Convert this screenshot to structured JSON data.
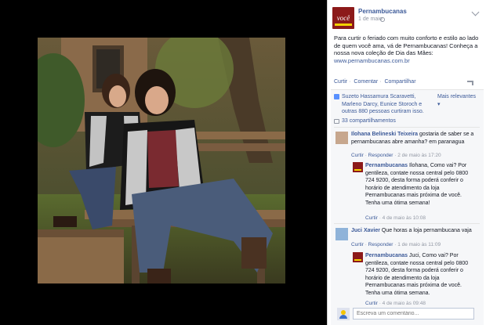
{
  "post": {
    "page_name": "Pernambucanas",
    "avatar_text": "você",
    "date": "1 de maio",
    "text": "Para curtir o feriado com muito conforto e estilo ao lado de quem você ama, vá de Pernambucanas! Conheça a nossa nova coleção de Dia das Mães:",
    "link": "www.pernambucanas.com.br"
  },
  "actions": {
    "like": "Curtir",
    "comment": "Comentar",
    "share": "Compartilhar",
    "sep": "·"
  },
  "likes": {
    "text": "Suzeto Hassamura Scaravetti, Marleno Darcy, Eunice Storoch e outras 880 pessoas curtiram isso.",
    "sort": "Mais relevantes ▾"
  },
  "shares": {
    "text": "33 compartilhamentos"
  },
  "comments": [
    {
      "author": "Ilohana Belineski Teixeira",
      "text": "gostaria de saber se a pernambucanas abre amanha? em paranagua",
      "meta_action1": "Curtir",
      "meta_action2": "Responder",
      "meta_time": "2 de maio às 17:20",
      "reply": {
        "author": "Pernambucanas",
        "text": "Ilohana, Como vai? Por gentileza, contate nossa central pelo 0800 724 9200, desta forma poderá conferir o horário de atendimento da loja Pernambucanas mais próxima de você. Tenha uma ótima semana!",
        "meta_action": "Curtir",
        "meta_time": "4 de maio às 10:08"
      }
    },
    {
      "author": "Juci Xavier",
      "text": "Que horas a loja pernambucana vaja",
      "meta_action1": "Curtir",
      "meta_action2": "Responder",
      "meta_time": "1 de maio às 11:09",
      "reply": {
        "author": "Pernambucanas",
        "text": "Juci, Como vai? Por gentileza, contate nossa central pelo 0800 724 9200, desta forma poderá conferir o horário de atendimento da loja Pernambucanas mais próxima de você. Tenha uma ótima semana.",
        "meta_action": "Curtir",
        "meta_time": "4 de maio às 09:48"
      }
    }
  ],
  "write_comment": {
    "placeholder": "Escreva um comentário..."
  },
  "colors": {
    "link": "#3b5998",
    "brand_red": "#8c1a1a",
    "brand_yellow": "#f3d100",
    "meta": "#9197a3"
  },
  "icons": [
    "photo-image",
    "globe-icon",
    "chevron-down-icon",
    "like-icon",
    "share-icon"
  ]
}
